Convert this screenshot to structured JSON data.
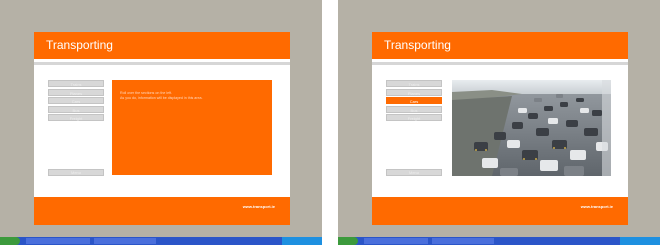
{
  "screens": [
    {
      "title": "Transporting",
      "nav_items": [
        "Trains",
        "Planes",
        "Cars",
        "Bus",
        "Freight"
      ],
      "active_index": -1,
      "nav_bottom": "Menu",
      "panel_text_line1": "Roll over the sections on the left.",
      "panel_text_line2": "As you do, information will be displayed in this area.",
      "footer_url": "www.transport.ie"
    },
    {
      "title": "Transporting",
      "nav_items": [
        "Trains",
        "Planes",
        "Cars",
        "Bus",
        "Freight"
      ],
      "active_index": 2,
      "nav_bottom": "Menu",
      "footer_url": "www.transport.ie"
    }
  ],
  "colors": {
    "accent": "#ff6a00",
    "desktop": "#b5b1a6",
    "taskbar": "#2b55c8",
    "nav_item": "#d8d8d8"
  }
}
